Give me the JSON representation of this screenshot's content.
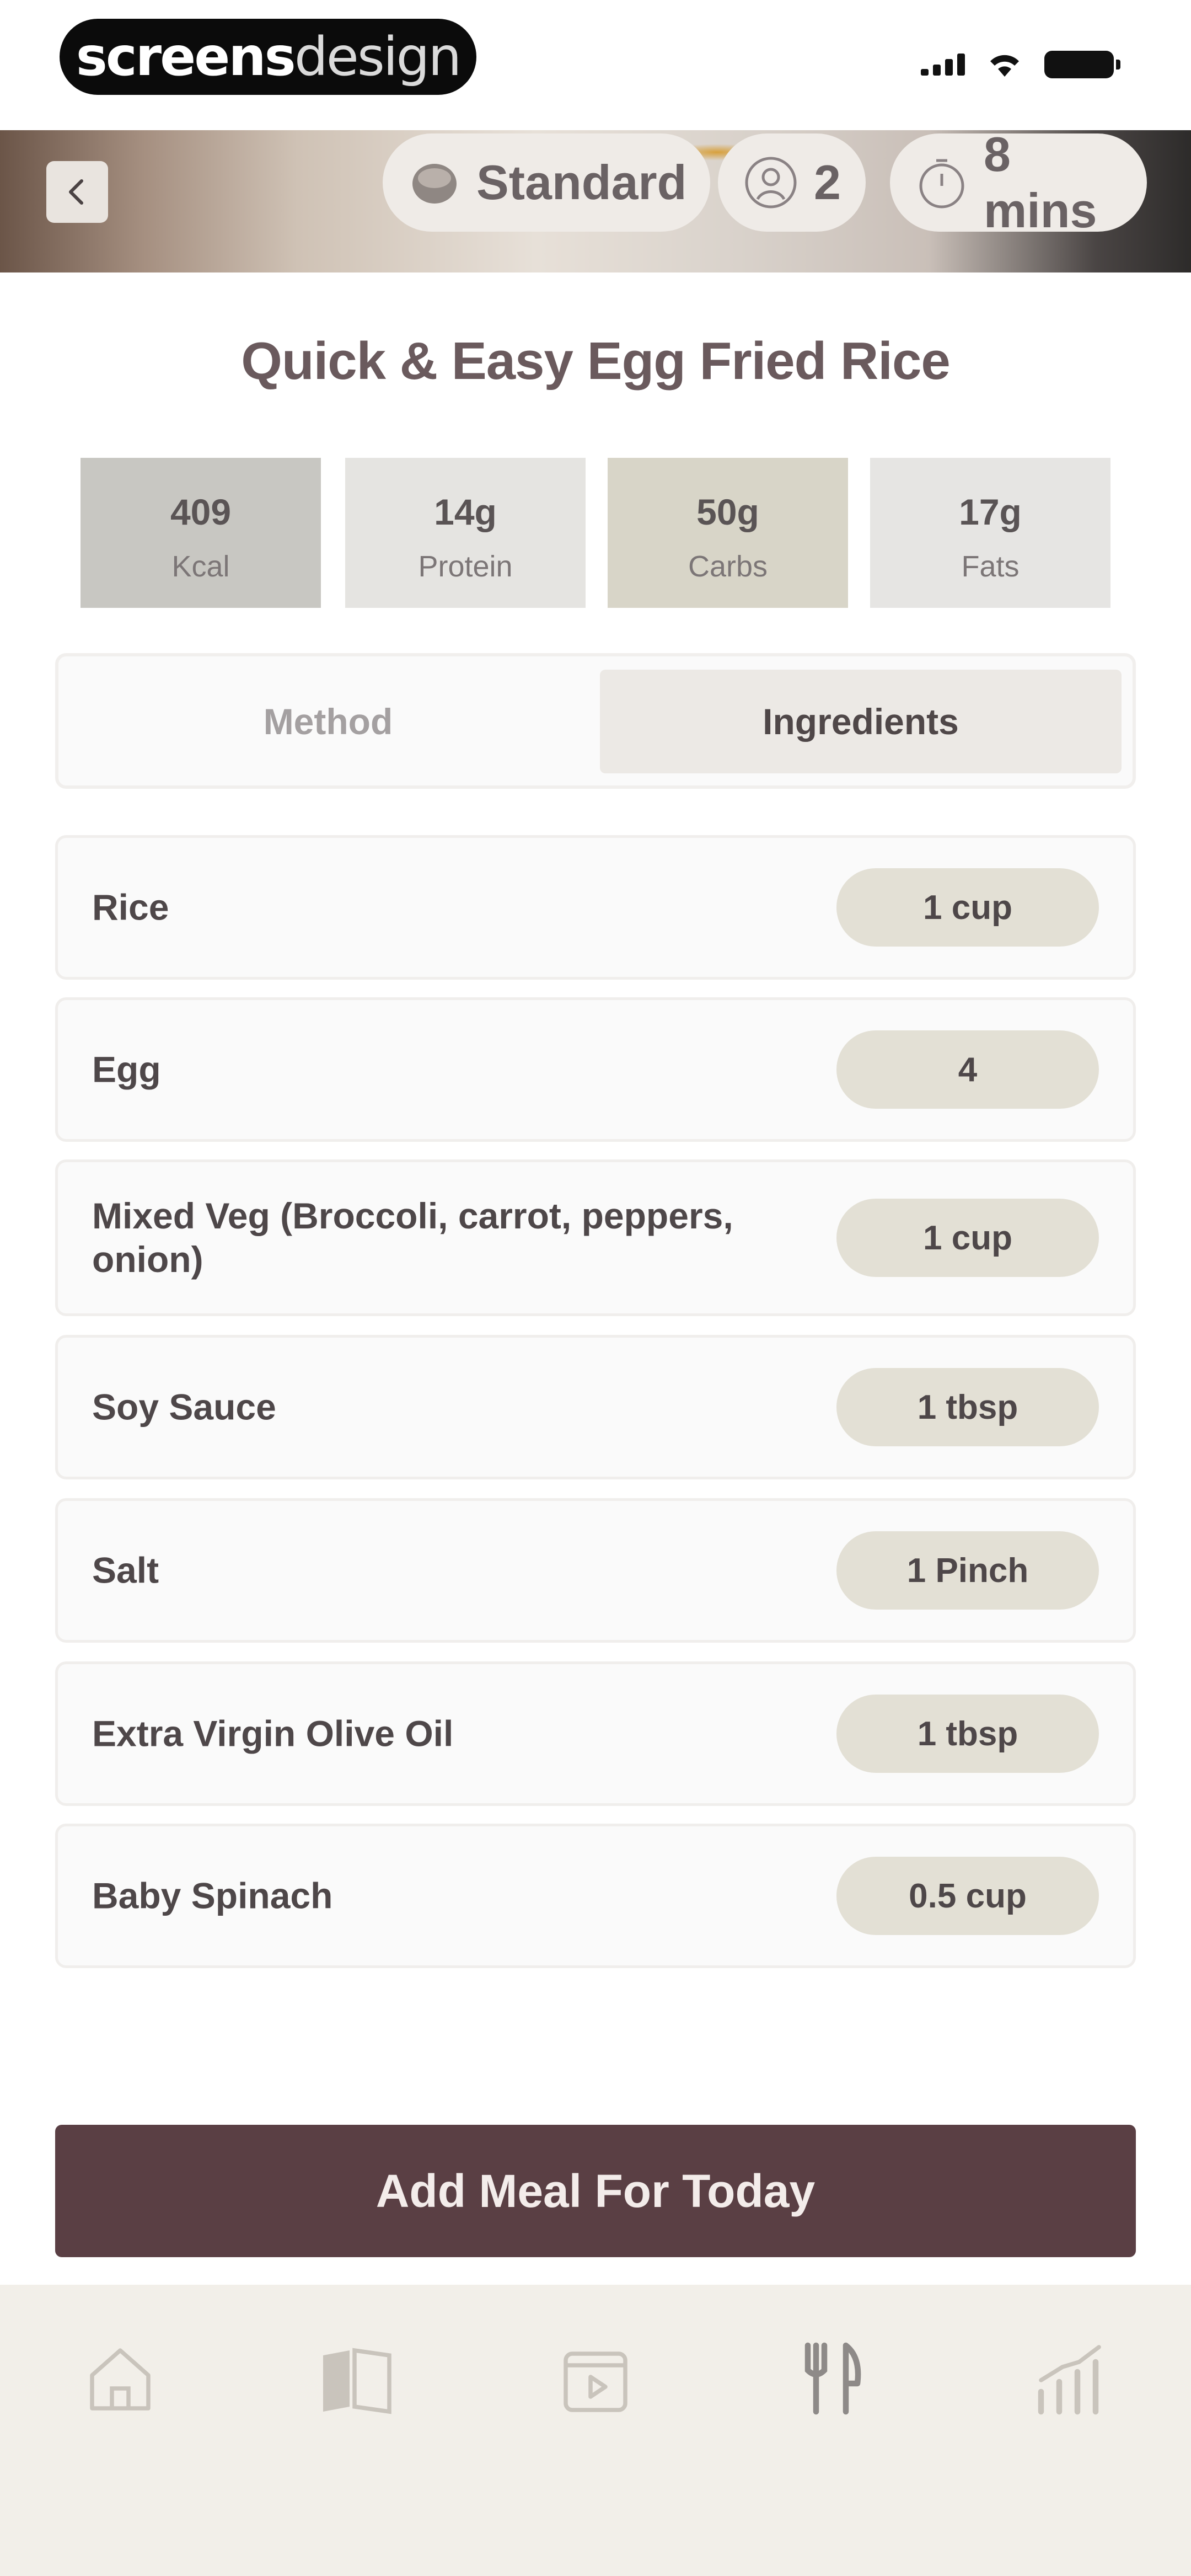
{
  "status_bar": {
    "brand_bold": "screens",
    "brand_light": "design"
  },
  "header": {
    "back_icon": "chevron-left-icon",
    "chips": [
      {
        "icon": "bowl-icon",
        "label": "Standard"
      },
      {
        "icon": "person-icon",
        "label": "2"
      },
      {
        "icon": "timer-icon",
        "label": "8 mins"
      }
    ]
  },
  "recipe": {
    "title": "Quick & Easy Egg Fried Rice"
  },
  "nutrition": [
    {
      "value": "409",
      "label": "Kcal",
      "color": "#c8c7c2"
    },
    {
      "value": "14g",
      "label": "Protein",
      "color": "#e5e4e1"
    },
    {
      "value": "50g",
      "label": "Carbs",
      "color": "#d8d5c8"
    },
    {
      "value": "17g",
      "label": "Fats",
      "color": "#e6e5e3"
    }
  ],
  "tabs": {
    "method": "Method",
    "ingredients": "Ingredients",
    "selected": "Ingredients"
  },
  "ingredients": [
    {
      "name": "Rice",
      "qty": "1 cup"
    },
    {
      "name": "Egg",
      "qty": "4"
    },
    {
      "name": "Mixed Veg (Broccoli, carrot, peppers, onion)",
      "qty": "1 cup"
    },
    {
      "name": "Soy Sauce",
      "qty": "1 tbsp"
    },
    {
      "name": "Salt",
      "qty": "1 Pinch"
    },
    {
      "name": "Extra Virgin Olive Oil",
      "qty": "1 tbsp"
    },
    {
      "name": "Baby Spinach",
      "qty": "0.5 cup"
    }
  ],
  "cta": {
    "label": "Add Meal For Today",
    "color": "#5a3f44"
  },
  "bottom_nav": [
    {
      "icon": "home-icon"
    },
    {
      "icon": "book-icon"
    },
    {
      "icon": "video-icon"
    },
    {
      "icon": "fork-knife-icon",
      "active": true
    },
    {
      "icon": "chart-icon"
    }
  ]
}
